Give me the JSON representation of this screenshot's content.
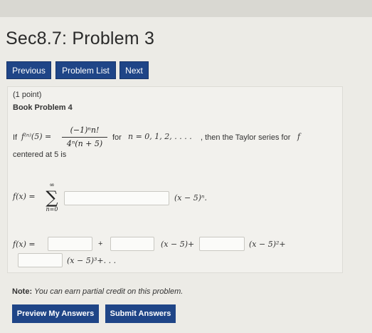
{
  "header": {
    "title": "Sec8.7: Problem 3"
  },
  "nav": {
    "previous": "Previous",
    "problem_list": "Problem List",
    "next": "Next"
  },
  "problem": {
    "points": "(1 point)",
    "name": "Book Problem 4",
    "intro_if": "If",
    "f_n_5": "f⁽ⁿ⁾(5) =",
    "frac_num": "(−1)ⁿn!",
    "frac_den": "4ⁿ(n + 5)",
    "for_text": "for",
    "n_range": "n = 0, 1, 2, . . . .",
    "then_text": ", then the Taylor series for",
    "f_symbol": "f",
    "centered": "centered at 5 is",
    "series_lhs": "f(x) =",
    "sigma_top": "∞",
    "sigma_symbol": "∑",
    "sigma_bottom": "n=0",
    "series_tail": "(x − 5)ⁿ.",
    "expand_lhs": "f(x) =",
    "plus": "+",
    "term1": "(x − 5)+",
    "term2": "(x − 5)²+",
    "term3": "(x − 5)³+. . ."
  },
  "footer": {
    "note_label": "Note:",
    "note_text": "You can earn partial credit on this problem.",
    "preview": "Preview My Answers",
    "submit": "Submit Answers"
  }
}
